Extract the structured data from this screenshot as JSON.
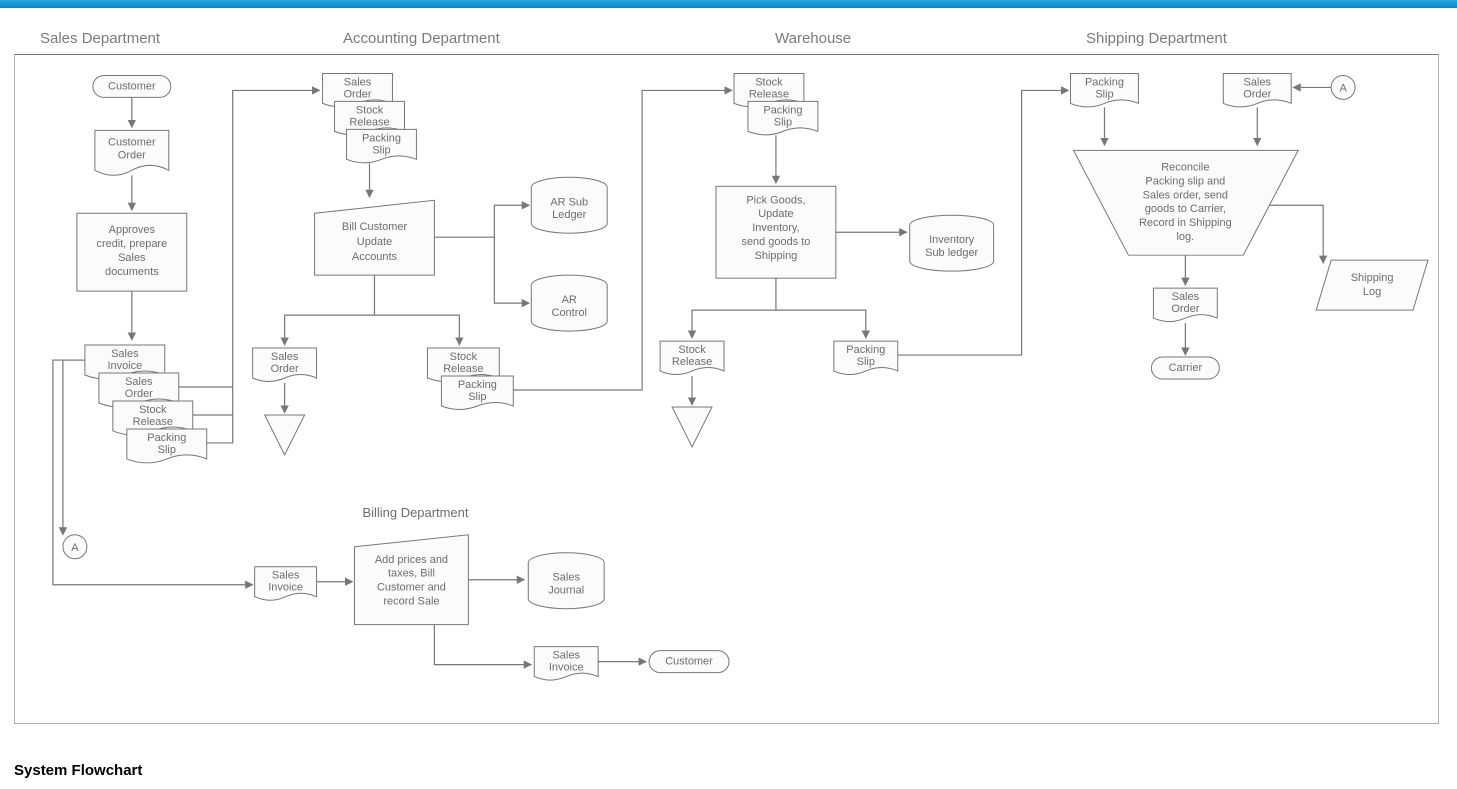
{
  "topbar_color": "#1a97d4",
  "caption": "System Flowchart",
  "lanes": {
    "sales": "Sales Department",
    "accounting": "Accounting Department",
    "warehouse": "Warehouse",
    "shipping": "Shipping Department",
    "billing": "Billing Department"
  },
  "connectors": {
    "A_left": "A",
    "A_right": "A"
  },
  "shapes": {
    "customer_start": "Customer",
    "customer_order": [
      "Customer",
      "Order"
    ],
    "approve": [
      "Approves",
      "credit, prepare",
      "Sales",
      "documents"
    ],
    "stack_sales": [
      "Sales",
      "Invoice",
      "Sales",
      "Order",
      "Stock",
      "Release",
      "Packing",
      "Slip"
    ],
    "acct_stack": [
      "Sales",
      "Order",
      "Stock",
      "Release",
      "Packing",
      "Slip"
    ],
    "bill_update": [
      "Bill Customer",
      "Update",
      "Accounts"
    ],
    "ar_sub": [
      "AR Sub",
      "Ledger"
    ],
    "ar_control": [
      "AR",
      "Control"
    ],
    "acct_sales_order": [
      "Sales",
      "Order"
    ],
    "acct_stock_pack": [
      "Stock",
      "Release",
      "Packing",
      "Slip"
    ],
    "wh_stack": [
      "Stock",
      "Release",
      "Packing",
      "Slip"
    ],
    "pick_goods": [
      "Pick Goods,",
      "Update",
      "Inventory,",
      "send goods to",
      "Shipping"
    ],
    "inv_sub": [
      "Inventory",
      "Sub ledger"
    ],
    "wh_stock_release": [
      "Stock",
      "Release"
    ],
    "wh_packing_slip": [
      "Packing",
      "Slip"
    ],
    "ship_packing_slip": [
      "Packing",
      "Slip"
    ],
    "ship_sales_order": [
      "Sales",
      "Order"
    ],
    "reconcile": [
      "Reconcile",
      "Packing slip and",
      "Sales order, send",
      "goods to Carrier,",
      "Record in Shipping",
      "log."
    ],
    "ship_log": [
      "Shipping",
      "Log"
    ],
    "ship_sales_order2": [
      "Sales",
      "Order"
    ],
    "carrier": "Carrier",
    "bill_sales_invoice_in": [
      "Sales",
      "Invoice"
    ],
    "bill_process": [
      "Add prices and",
      "taxes, Bill",
      "Customer and",
      "record Sale"
    ],
    "sales_journal": [
      "Sales",
      "Journal"
    ],
    "bill_sales_invoice_out": [
      "Sales",
      "Invoice"
    ],
    "customer_end": "Customer"
  }
}
